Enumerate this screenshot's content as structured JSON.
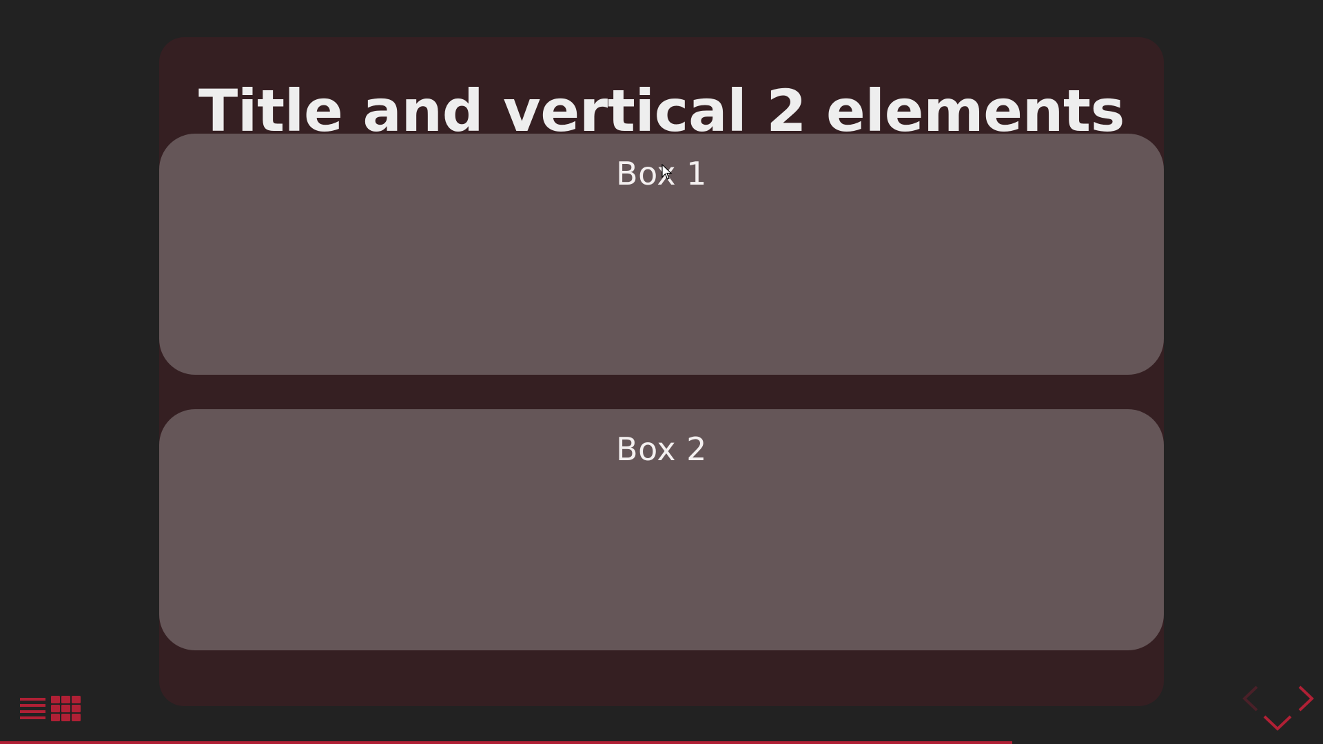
{
  "slide": {
    "title": "Title and vertical 2 elements",
    "boxes": [
      {
        "label": "Box 1"
      },
      {
        "label": "Box 2"
      }
    ]
  },
  "controls": {
    "menu_icon": "hamburger-menu-icon",
    "overview_icon": "grid-overview-icon",
    "nav_left_icon": "chevron-left-icon",
    "nav_right_icon": "chevron-right-icon",
    "nav_down_icon": "chevron-down-icon"
  },
  "progress": {
    "fraction": 0.765
  },
  "colors": {
    "background": "#222222",
    "slide_background": "#351f22",
    "box_background": "#655658",
    "title_text": "#eeeeee",
    "accent": "#b02035",
    "accent_dim": "#4a2028"
  }
}
